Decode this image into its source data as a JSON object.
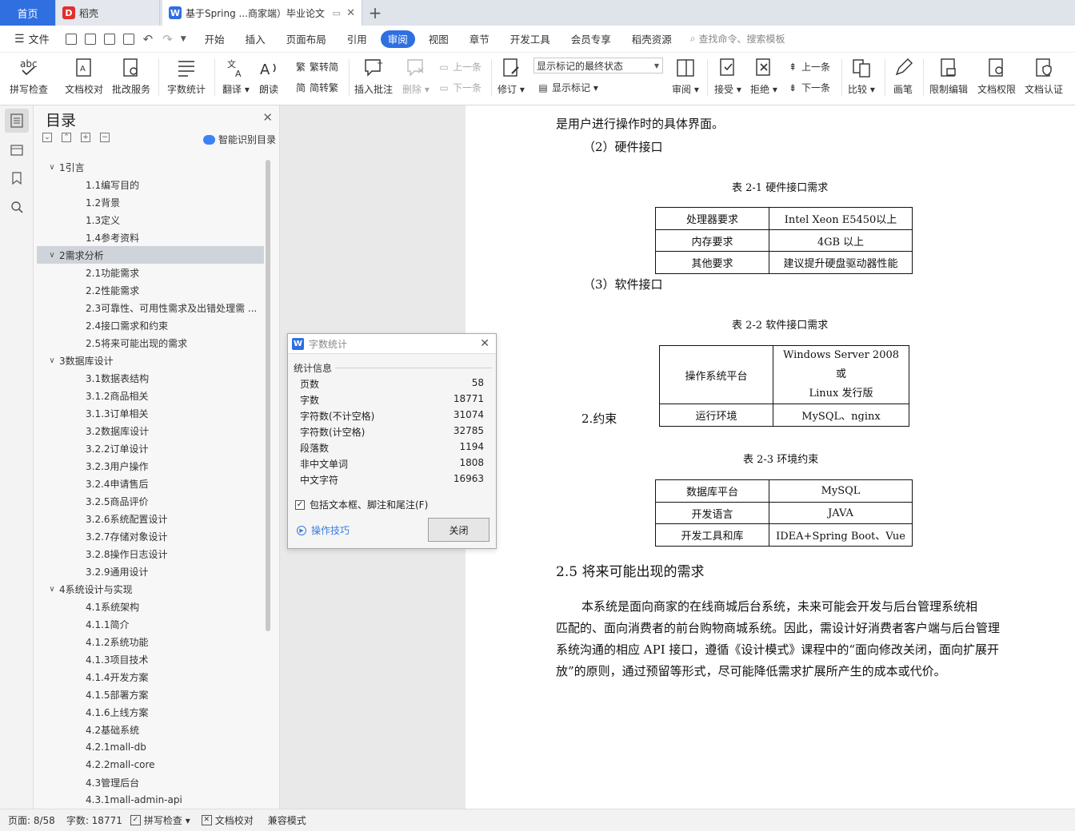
{
  "tabs": {
    "home": "首页",
    "daoke": "稻壳",
    "doc": "基于Spring ...商家端）毕业论文"
  },
  "menu": {
    "file": "文件",
    "items": [
      "开始",
      "插入",
      "页面布局",
      "引用",
      "审阅",
      "视图",
      "章节",
      "开发工具",
      "会员专享",
      "稻壳资源"
    ],
    "active_index": 4,
    "search": "查找命令、搜索模板"
  },
  "ribbon": {
    "spell": "拼写检查",
    "proofread": "文档校对",
    "correction": "批改服务",
    "wordcount": "字数统计",
    "translate": "翻译",
    "read": "朗读",
    "trad": "繁转简",
    "simp": "简转繁",
    "insert_comment": "插入批注",
    "delete": "删除",
    "prev": "上一条",
    "next": "下一条",
    "track": "修订",
    "markup_select": "显示标记的最终状态",
    "show_markup": "显示标记",
    "review": "审阅",
    "accept": "接受",
    "reject": "拒绝",
    "prev2": "上一条",
    "next2": "下一条",
    "compare": "比较",
    "pen": "画笔",
    "restrict": "限制编辑",
    "permission": "文档权限",
    "auth": "文档认证"
  },
  "toc": {
    "title": "目录",
    "smart": "智能识别目录",
    "items": [
      {
        "label": "1引言",
        "level": 1,
        "expanded": true
      },
      {
        "label": "1.1编写目的",
        "level": 2
      },
      {
        "label": "1.2背景",
        "level": 2
      },
      {
        "label": "1.3定义",
        "level": 2
      },
      {
        "label": "1.4参考资料",
        "level": 2
      },
      {
        "label": "2需求分析",
        "level": 1,
        "expanded": true,
        "selected": true
      },
      {
        "label": "2.1功能需求",
        "level": 2
      },
      {
        "label": "2.2性能需求",
        "level": 2
      },
      {
        "label": "2.3可靠性、可用性需求及出错处理需 ...",
        "level": 2
      },
      {
        "label": "2.4接口需求和约束",
        "level": 2
      },
      {
        "label": "2.5将来可能出现的需求",
        "level": 2
      },
      {
        "label": "3数据库设计",
        "level": 1,
        "expanded": true
      },
      {
        "label": "3.1数据表结构",
        "level": 2
      },
      {
        "label": "3.1.2商品相关",
        "level": 2
      },
      {
        "label": "3.1.3订单相关",
        "level": 2
      },
      {
        "label": "3.2数据库设计",
        "level": 2
      },
      {
        "label": "3.2.2订单设计",
        "level": 2
      },
      {
        "label": "3.2.3用户操作",
        "level": 2
      },
      {
        "label": "3.2.4申请售后",
        "level": 2
      },
      {
        "label": "3.2.5商品评价",
        "level": 2
      },
      {
        "label": "3.2.6系统配置设计",
        "level": 2
      },
      {
        "label": "3.2.7存储对象设计",
        "level": 2
      },
      {
        "label": "3.2.8操作日志设计",
        "level": 2
      },
      {
        "label": "3.2.9通用设计",
        "level": 2
      },
      {
        "label": "4系统设计与实现",
        "level": 1,
        "expanded": true
      },
      {
        "label": "4.1系统架构",
        "level": 2
      },
      {
        "label": "4.1.1简介",
        "level": 2
      },
      {
        "label": "4.1.2系统功能",
        "level": 2
      },
      {
        "label": "4.1.3项目技术",
        "level": 2
      },
      {
        "label": "4.1.4开发方案",
        "level": 2
      },
      {
        "label": "4.1.5部署方案",
        "level": 2
      },
      {
        "label": "4.1.6上线方案",
        "level": 2
      },
      {
        "label": "4.2基础系统",
        "level": 2
      },
      {
        "label": "4.2.1mall-db",
        "level": 2
      },
      {
        "label": "4.2.2mall-core",
        "level": 2
      },
      {
        "label": "4.3管理后台",
        "level": 2
      },
      {
        "label": "4.3.1mall-admin-api",
        "level": 2
      }
    ]
  },
  "dialog": {
    "title": "字数统计",
    "section": "统计信息",
    "stats": [
      {
        "label": "页数",
        "value": "58"
      },
      {
        "label": "字数",
        "value": "18771"
      },
      {
        "label": "字符数(不计空格)",
        "value": "31074"
      },
      {
        "label": "字符数(计空格)",
        "value": "32785"
      },
      {
        "label": "段落数",
        "value": "1194"
      },
      {
        "label": "非中文单词",
        "value": "1808"
      },
      {
        "label": "中文字符",
        "value": "16963"
      }
    ],
    "include": "包括文本框、脚注和尾注(F)",
    "include_checked": true,
    "tips": "操作技巧",
    "close": "关闭"
  },
  "document": {
    "line1": "是用户进行操作时的具体界面。",
    "hw_heading": "（2）硬件接口",
    "table1_caption": "表  2-1 硬件接口需求",
    "table1": [
      [
        "处理器要求",
        "Intel Xeon E5450以上"
      ],
      [
        "内存要求",
        "4GB 以上"
      ],
      [
        "其他要求",
        "建议提升硬盘驱动器性能"
      ]
    ],
    "sw_heading": "（3）软件接口",
    "table2_caption": "表  2-2 软件接口需求",
    "table2_r1_label": "操作系统平台",
    "table2_r1_line1": "Windows Server 2008 或",
    "table2_r1_line2": "Linux 发行版",
    "table2_r2_label": "运行环境",
    "table2_r2_value": "MySQL、nginx",
    "constraint_heading": "2.约束",
    "table3_caption": "表  2-3 环境约束",
    "table3": [
      [
        "数据库平台",
        "MySQL"
      ],
      [
        "开发语言",
        "JAVA"
      ],
      [
        "开发工具和库",
        "IDEA+Spring Boot、Vue"
      ]
    ],
    "section_title": "2.5 将来可能出现的需求",
    "para": [
      "本系统是面向商家的在线商城后台系统，未来可能会开发与后台管理系统相",
      "匹配的、面向消费者的前台购物商城系统。因此，需设计好消费者客户端与后台管理",
      "系统沟通的相应 API 接口，遵循《设计模式》课程中的“面向修改关闭，面向扩展开",
      "放”的原则，通过预留等形式，尽可能降低需求扩展所产生的成本或代价。"
    ]
  },
  "status": {
    "page": "页面: 8/58",
    "words": "字数: 18771",
    "spell": "拼写检查",
    "proof": "文档校对",
    "compat": "兼容模式"
  },
  "colors": {
    "accent": "#2f6fe0",
    "toc_selected": "#cfd3da",
    "link": "#3a7be0"
  }
}
